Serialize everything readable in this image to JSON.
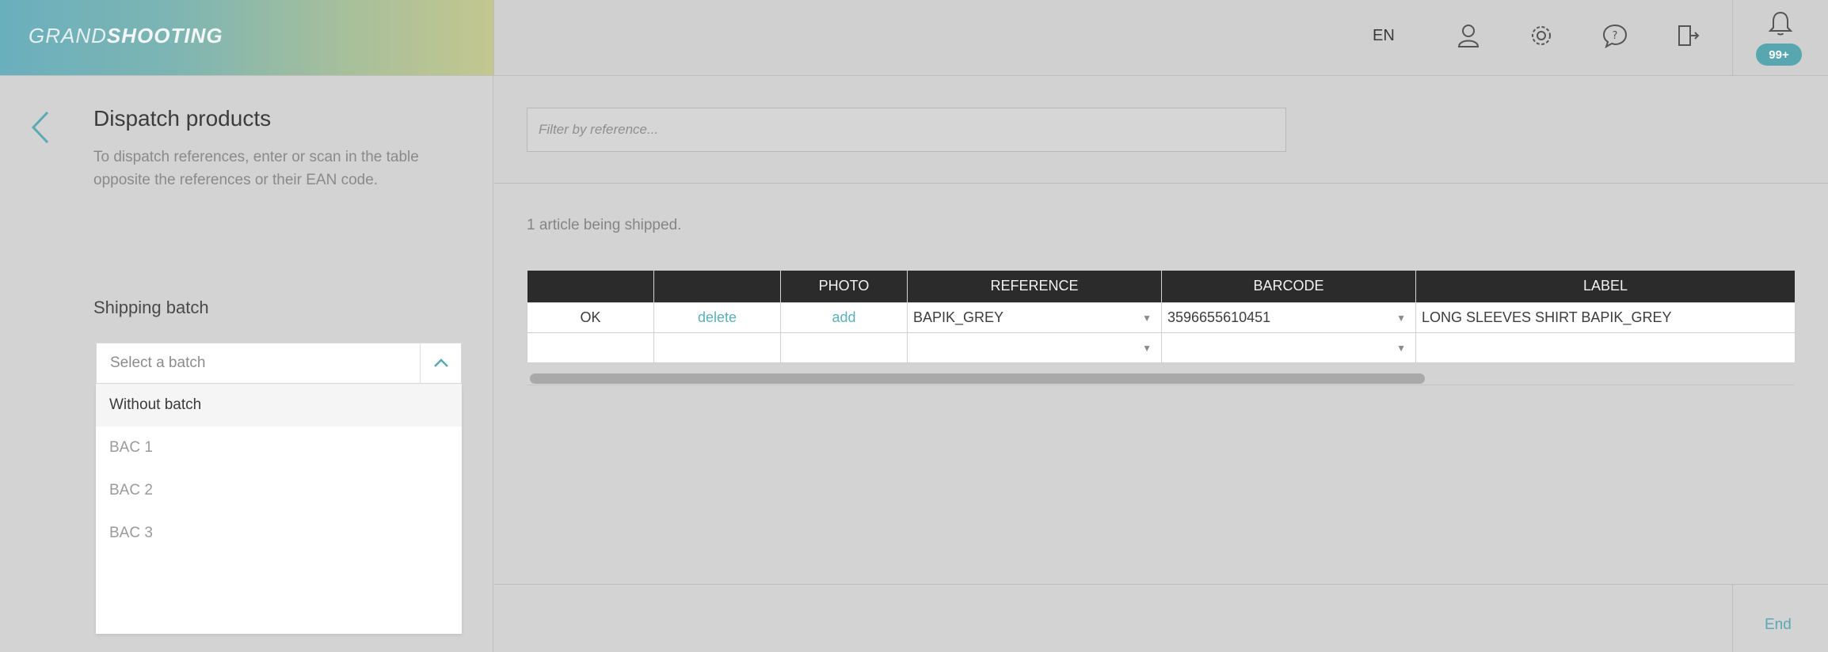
{
  "header": {
    "logo_light": "GRAND",
    "logo_bold": "SHOOTING",
    "language": "EN",
    "icons": [
      "user-icon",
      "settings-icon",
      "help-icon",
      "logout-icon",
      "bell-icon"
    ],
    "notification_count": "99+",
    "accent_color": "#57a6b0"
  },
  "left": {
    "title": "Dispatch products",
    "subtitle": "To dispatch references, enter or scan in the table opposite the references or their EAN code.",
    "batch_label": "Shipping batch",
    "batch_placeholder": "Select a batch",
    "batch_options": [
      "Without batch",
      "BAC 1",
      "BAC 2",
      "BAC 3"
    ]
  },
  "main": {
    "filter_placeholder": "Filter by reference...",
    "shipped_text": "1 article being shipped.",
    "columns": [
      "",
      "",
      "PHOTO",
      "REFERENCE",
      "BARCODE",
      "LABEL"
    ],
    "rows": [
      {
        "status": "OK",
        "action": "delete",
        "photo": "add",
        "reference": "BAPIK_GREY",
        "barcode": "3596655610451",
        "label": "LONG SLEEVES SHIRT BAPIK_GREY"
      },
      {
        "status": "",
        "action": "",
        "photo": "",
        "reference": "",
        "barcode": "",
        "label": ""
      }
    ],
    "end_label": "End"
  }
}
